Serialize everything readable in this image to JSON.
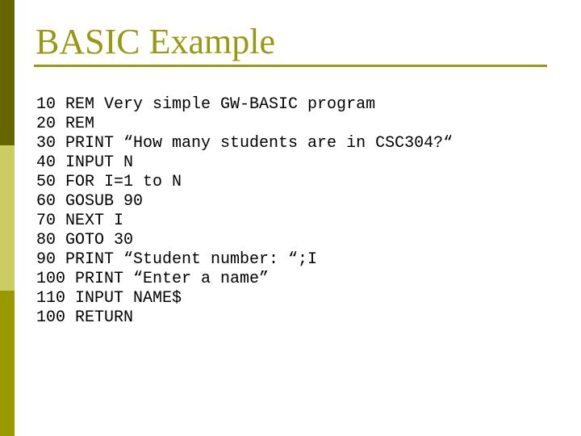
{
  "slide": {
    "title": "BASIC Example",
    "colors": {
      "accent_title": "#999911",
      "sidebar_top": "#666600",
      "sidebar_middle": "#cccc66",
      "sidebar_bottom": "#999900",
      "code_text": "#000000",
      "background": "#ffffff"
    },
    "code_lines": [
      "10 REM Very simple GW-BASIC program",
      "20 REM",
      "30 PRINT “How many students are in CSC304?“",
      "40 INPUT N",
      "50 FOR I=1 to N",
      "60 GOSUB 90",
      "70 NEXT I",
      "80 GOTO 30",
      "90 PRINT “Student number: “;I",
      "100 PRINT “Enter a name”",
      "110 INPUT NAME$",
      "100 RETURN"
    ]
  }
}
